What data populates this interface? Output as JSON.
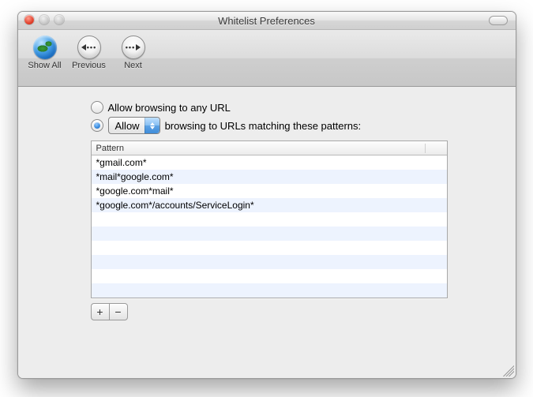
{
  "window": {
    "title": "Whitelist Preferences"
  },
  "toolbar": {
    "show_all_label": "Show All",
    "previous_label": "Previous",
    "next_label": "Next"
  },
  "options": {
    "allow_any_label": "Allow browsing to any URL",
    "mode_popup_value": "Allow",
    "mode_suffix_label": "browsing to URLs matching these patterns:",
    "selected": "patterns"
  },
  "table": {
    "header": "Pattern",
    "rows": [
      "*gmail.com*",
      "*mail*google.com*",
      "*google.com*mail*",
      "*google.com*/accounts/ServiceLogin*"
    ],
    "visible_row_slots": 10
  },
  "buttons": {
    "add_label": "+",
    "remove_label": "−"
  }
}
